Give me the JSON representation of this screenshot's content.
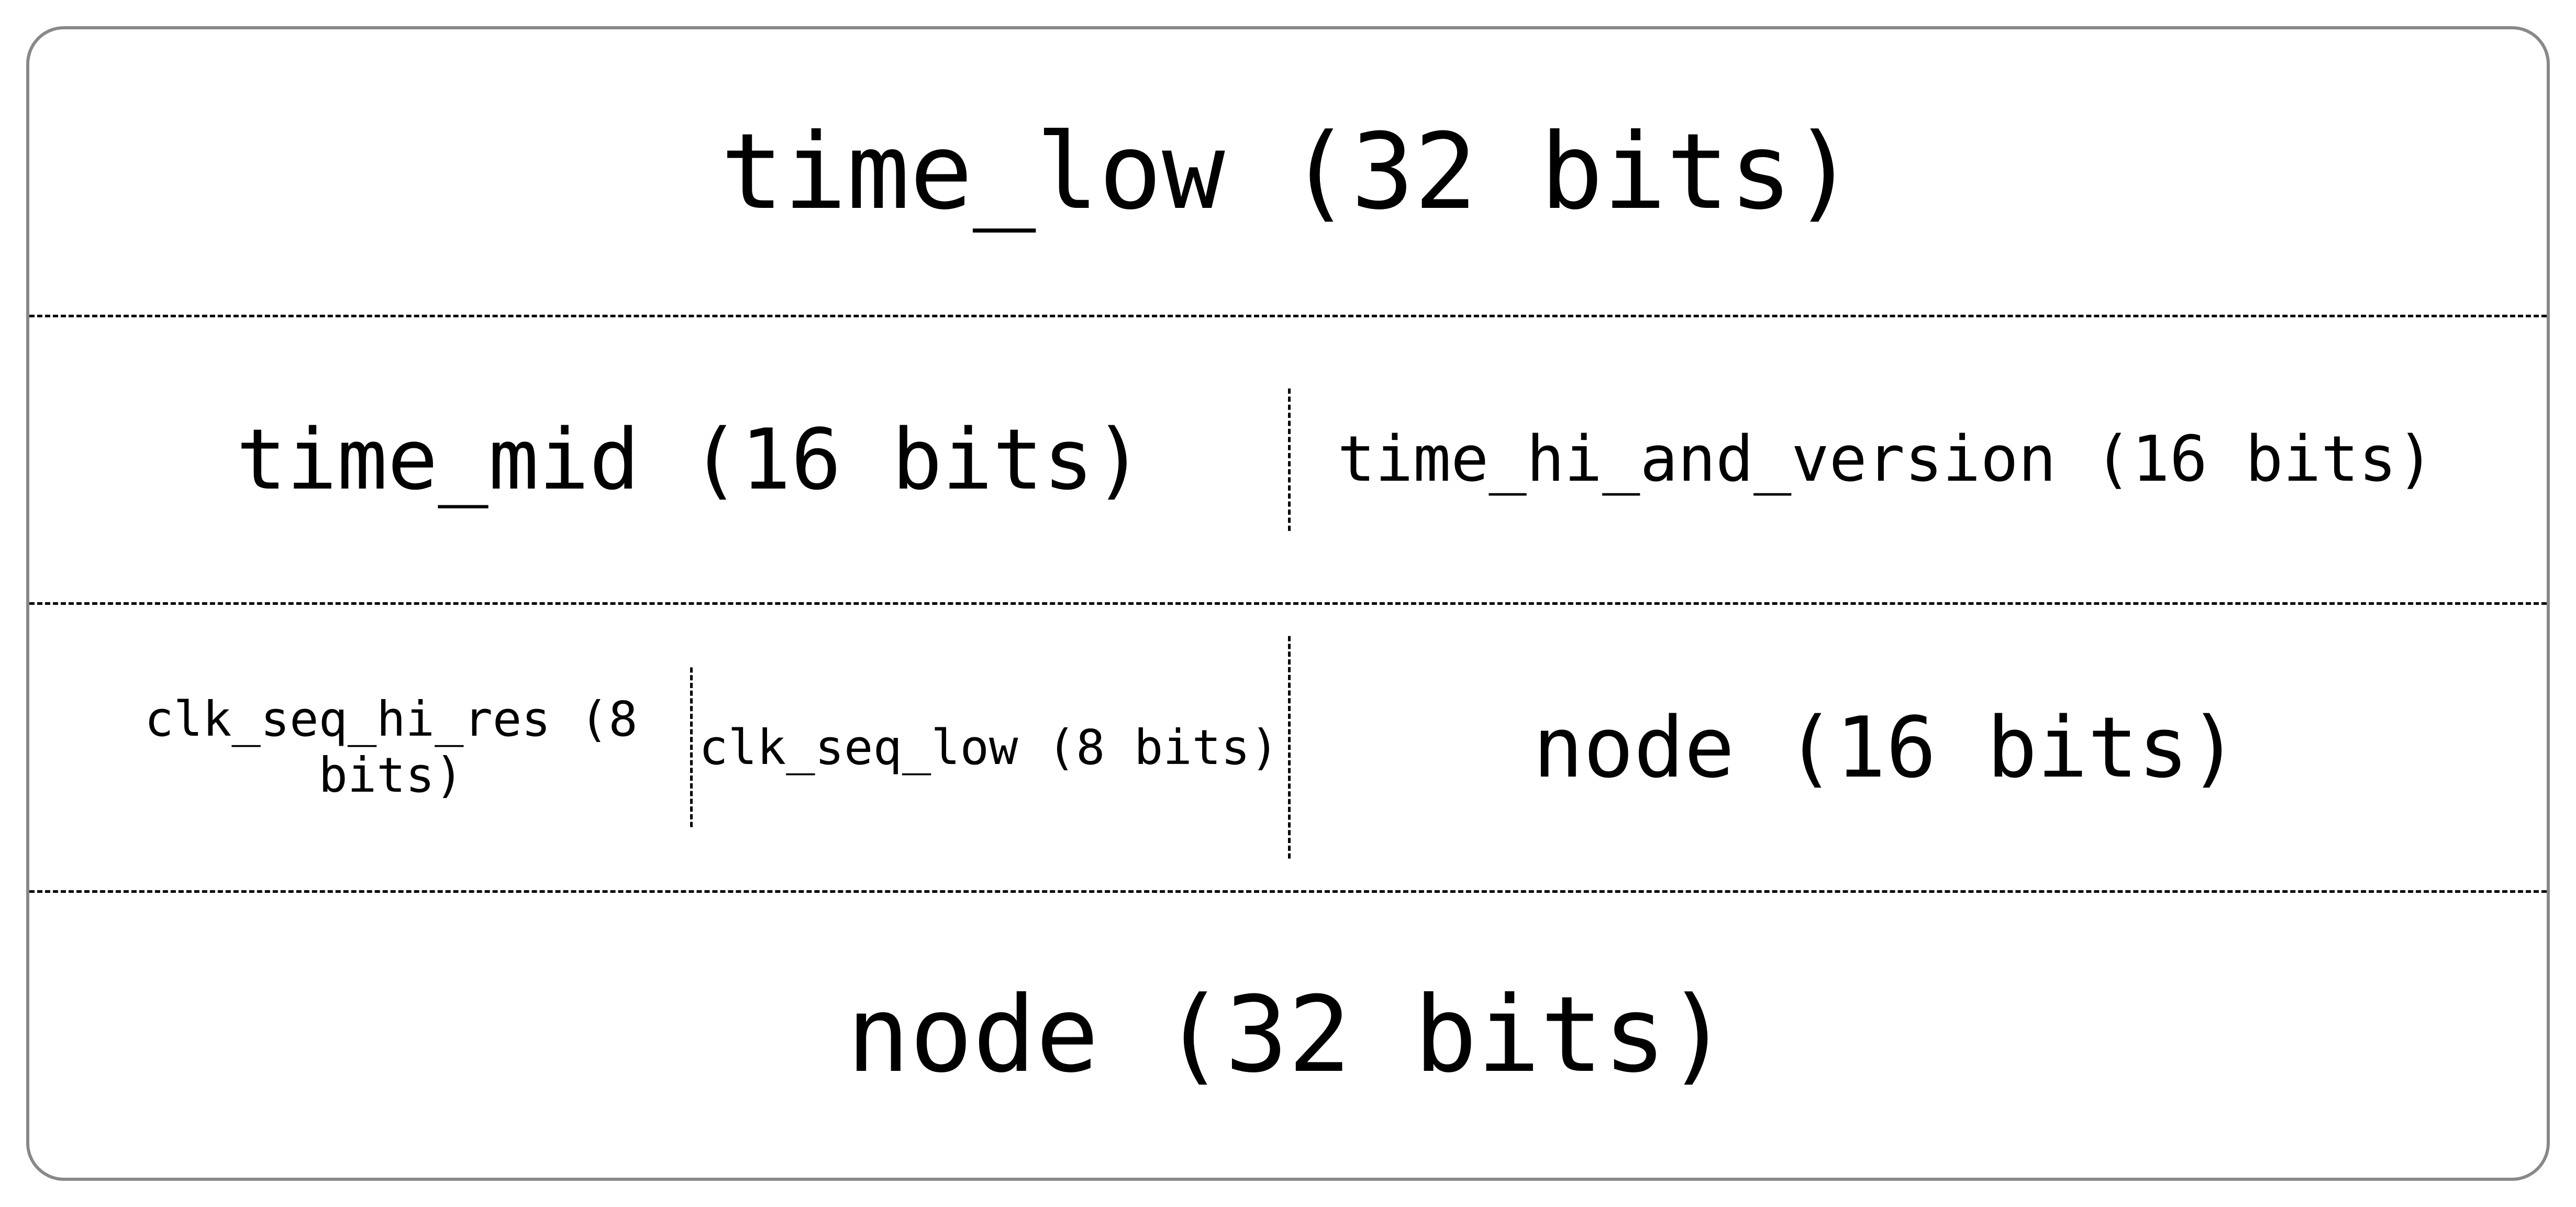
{
  "rows": [
    {
      "cells": [
        {
          "label": "time_low (32 bits)",
          "size": "xl"
        }
      ]
    },
    {
      "cells": [
        {
          "label": "time_mid (16 bits)",
          "size": "l"
        },
        {
          "label": "time_hi_and_version (16 bits)",
          "size": "m"
        }
      ]
    },
    {
      "cells_left": [
        {
          "label": "clk_seq_hi_res (8 bits)",
          "size": "s"
        },
        {
          "label": "clk_seq_low (8 bits)",
          "size": "s"
        }
      ],
      "cells_right": [
        {
          "label": "node (16 bits)",
          "size": "l"
        }
      ]
    },
    {
      "cells": [
        {
          "label": "node (32 bits)",
          "size": "xl"
        }
      ]
    }
  ]
}
